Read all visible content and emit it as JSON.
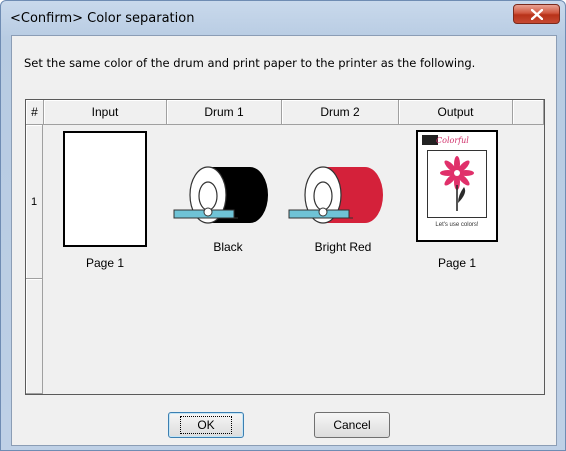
{
  "window": {
    "title": "<Confirm> Color separation",
    "close_label": "x"
  },
  "instruction": "Set the same color of the drum and print paper to the printer as the following.",
  "table": {
    "columns": [
      "#",
      "Input",
      "Drum 1",
      "Drum 2",
      "Output",
      ""
    ],
    "rows": [
      {
        "index": "1",
        "input_label": "Page 1",
        "drum1_label": "Black",
        "drum2_label": "Bright Red",
        "output_label": "Page 1"
      }
    ]
  },
  "output_thumbnail": {
    "logo_text": "Colorful",
    "caption": "Let's use colors!"
  },
  "colors": {
    "drum1": "#000000",
    "drum2": "#d4213a",
    "tray": "#6fc3d6",
    "flower": "#e0306a",
    "leaf": "#2a2a2a"
  },
  "buttons": {
    "ok": "OK",
    "cancel": "Cancel"
  }
}
